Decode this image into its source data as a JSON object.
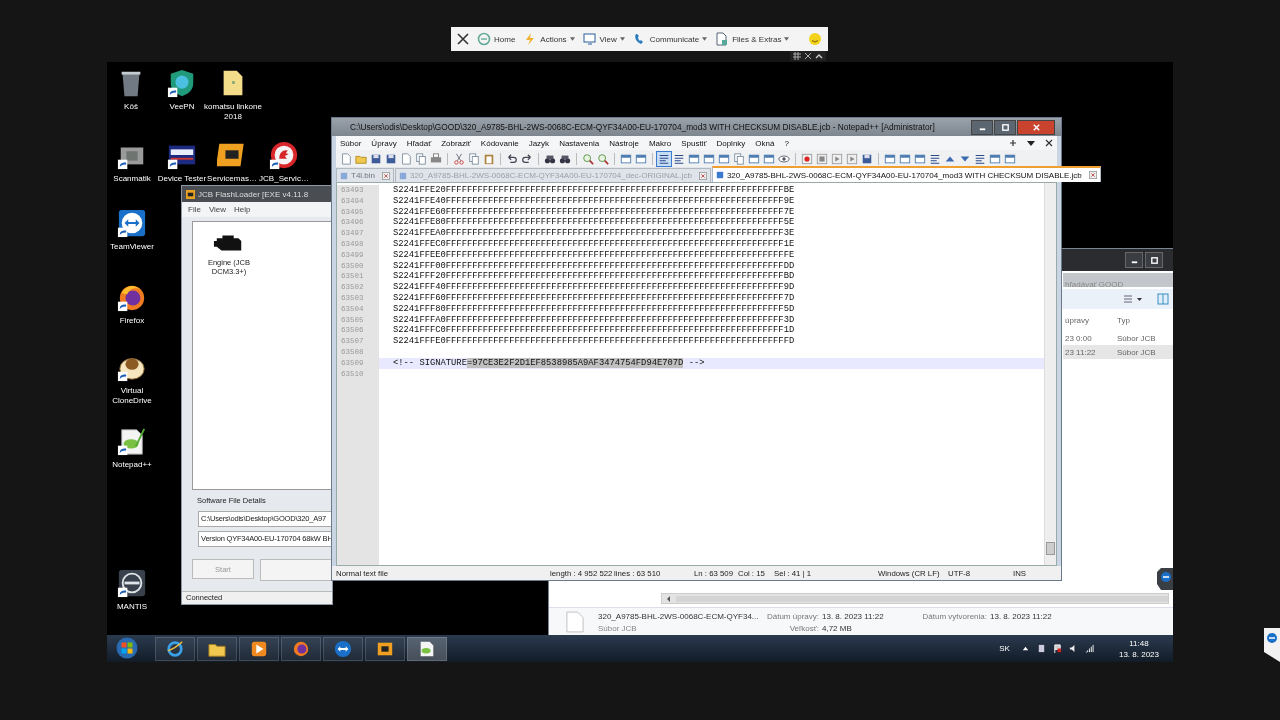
{
  "remote_toolbar": {
    "items": [
      {
        "label": "Home",
        "dropdown": false
      },
      {
        "label": "Actions",
        "dropdown": true
      },
      {
        "label": "View",
        "dropdown": true
      },
      {
        "label": "Communicate",
        "dropdown": true
      },
      {
        "label": "Files & Extras",
        "dropdown": true
      }
    ]
  },
  "desktop_icons": [
    {
      "label": "Kôš"
    },
    {
      "label": "VeePN"
    },
    {
      "label": "komatsu linkone 2018"
    },
    {
      "label": "Scanmatik"
    },
    {
      "label": "Device Tester"
    },
    {
      "label": "Servicemas…"
    },
    {
      "label": "JCB_Servic…"
    },
    {
      "label": "TeamViewer"
    },
    {
      "label": "Firefox"
    },
    {
      "label": "Virtual CloneDrive"
    },
    {
      "label": "Notepad++"
    },
    {
      "label": "MANTIS"
    }
  ],
  "flashloader": {
    "title": "JCB FlashLoader [EXE v4.11.8",
    "menu": [
      "File",
      "View",
      "Help"
    ],
    "module": "Engine (JCB DCM3.3+)",
    "details_label": "Software File Details",
    "file_path": "C:\\Users\\odis\\Desktop\\GOOD\\320_A97",
    "version": "Version QYF34A00-EU-170704 68kW BH",
    "start_button": "Start",
    "status": "Connected"
  },
  "notepad": {
    "title": "C:\\Users\\odis\\Desktop\\GOOD\\320_A9785-BHL-2WS-0068C-ECM-QYF34A00-EU-170704_mod3 WITH CHECKSUM DISABLE.jcb - Notepad++ [Administrator]",
    "menu": [
      "Súbor",
      "Úpravy",
      "Hľadať",
      "Zobraziť",
      "Kódovanie",
      "Jazyk",
      "Nastavenia",
      "Nástroje",
      "Makro",
      "Spustiť",
      "Doplnky",
      "Okná",
      "?"
    ],
    "tabs": [
      {
        "label": "T4l.bin",
        "selected": false
      },
      {
        "label": "320_A9785-BHL-2WS-0068C-ECM-QYF34A00-EU-170704_dec-ORIGINAL.jcb",
        "selected": false
      },
      {
        "label": "320_A9785-BHL-2WS-0068C-ECM-QYF34A00-EU-170704_mod3 WITH CHECKSUM DISABLE.jcb",
        "selected": true
      }
    ],
    "lines": [
      {
        "number": "63493",
        "current": false,
        "text": "S2241FFE20FFFFFFFFFFFFFFFFFFFFFFFFFFFFFFFFFFFFFFFFFFFFFFFFFFFFFFFFFFFFFFFFBE"
      },
      {
        "number": "63494",
        "current": false,
        "text": "S2241FFE40FFFFFFFFFFFFFFFFFFFFFFFFFFFFFFFFFFFFFFFFFFFFFFFFFFFFFFFFFFFFFFFF9E"
      },
      {
        "number": "63495",
        "current": false,
        "text": "S2241FFE60FFFFFFFFFFFFFFFFFFFFFFFFFFFFFFFFFFFFFFFFFFFFFFFFFFFFFFFFFFFFFFFF7E"
      },
      {
        "number": "63496",
        "current": false,
        "text": "S2241FFE80FFFFFFFFFFFFFFFFFFFFFFFFFFFFFFFFFFFFFFFFFFFFFFFFFFFFFFFFFFFFFFFF5E"
      },
      {
        "number": "63497",
        "current": false,
        "text": "S2241FFEA0FFFFFFFFFFFFFFFFFFFFFFFFFFFFFFFFFFFFFFFFFFFFFFFFFFFFFFFFFFFFFFFF3E"
      },
      {
        "number": "63498",
        "current": false,
        "text": "S2241FFEC0FFFFFFFFFFFFFFFFFFFFFFFFFFFFFFFFFFFFFFFFFFFFFFFFFFFFFFFFFFFFFFFF1E"
      },
      {
        "number": "63499",
        "current": false,
        "text": "S2241FFEE0FFFFFFFFFFFFFFFFFFFFFFFFFFFFFFFFFFFFFFFFFFFFFFFFFFFFFFFFFFFFFFFFFE"
      },
      {
        "number": "63500",
        "current": false,
        "text": "S2241FFF00FFFFFFFFFFFFFFFFFFFFFFFFFFFFFFFFFFFFFFFFFFFFFFFFFFFFFFFFFFFFFFFFDD"
      },
      {
        "number": "63501",
        "current": false,
        "text": "S2241FFF20FFFFFFFFFFFFFFFFFFFFFFFFFFFFFFFFFFFFFFFFFFFFFFFFFFFFFFFFFFFFFFFFBD"
      },
      {
        "number": "63502",
        "current": false,
        "text": "S2241FFF40FFFFFFFFFFFFFFFFFFFFFFFFFFFFFFFFFFFFFFFFFFFFFFFFFFFFFFFFFFFFFFFF9D"
      },
      {
        "number": "63503",
        "current": false,
        "text": "S2241FFF60FFFFFFFFFFFFFFFFFFFFFFFFFFFFFFFFFFFFFFFFFFFFFFFFFFFFFFFFFFFFFFFF7D"
      },
      {
        "number": "63504",
        "current": false,
        "text": "S2241FFF80FFFFFFFFFFFFFFFFFFFFFFFFFFFFFFFFFFFFFFFFFFFFFFFFFFFFFFFFFFFFFFFF5D"
      },
      {
        "number": "63505",
        "current": false,
        "text": "S2241FFFA0FFFFFFFFFFFFFFFFFFFFFFFFFFFFFFFFFFFFFFFFFFFFFFFFFFFFFFFFFFFFFFFF3D"
      },
      {
        "number": "63506",
        "current": false,
        "text": "S2241FFFC0FFFFFFFFFFFFFFFFFFFFFFFFFFFFFFFFFFFFFFFFFFFFFFFFFFFFFFFFFFFFFFFF1D"
      },
      {
        "number": "63507",
        "current": false,
        "text": "S2241FFFE0FFFFFFFFFFFFFFFFFFFFFFFFFFFFFFFFFFFFFFFFFFFFFFFFFFFFFFFFFFFFFFFFFD"
      },
      {
        "number": "63508",
        "current": false
      },
      {
        "number": "63509",
        "current": true,
        "text": "<!-- SIGNATURE",
        "selection": "=97CE3E2F2D1EF8538985A9AF3474754FD94E707D",
        "tail": " -->"
      },
      {
        "number": "63510",
        "current": false
      }
    ],
    "status_bar": [
      "Normal text file",
      "length : 4 952 522",
      "lines : 63 510",
      "Ln : 63 509",
      "Col : 15",
      "Sel : 41 | 1",
      "Windows (CR LF)",
      "UTF-8",
      "INS"
    ]
  },
  "explorer": {
    "search": "hľadávať GOOD",
    "columns": [
      "úpravy",
      "Typ"
    ],
    "rows": [
      {
        "modified": "23 0:00",
        "type": "Súbor JCB",
        "selected": false
      },
      {
        "modified": "23 11:22",
        "type": "Súbor JCB",
        "selected": true
      }
    ],
    "details": {
      "file_name": "320_A9785-BHL-2WS-0068C-ECM-QYF34...",
      "file_type": "Súbor JCB",
      "modified_label": "Dátum úpravy:",
      "modified": "13. 8. 2023 11:22",
      "size_label": "Veľkosť:",
      "size": "4,72 MB",
      "created_label": "Dátum vytvorenia:",
      "created": "13. 8. 2023 11:22"
    }
  },
  "taskbar": {
    "language": "SK",
    "time": "11:48",
    "date": "13. 8. 2023"
  }
}
